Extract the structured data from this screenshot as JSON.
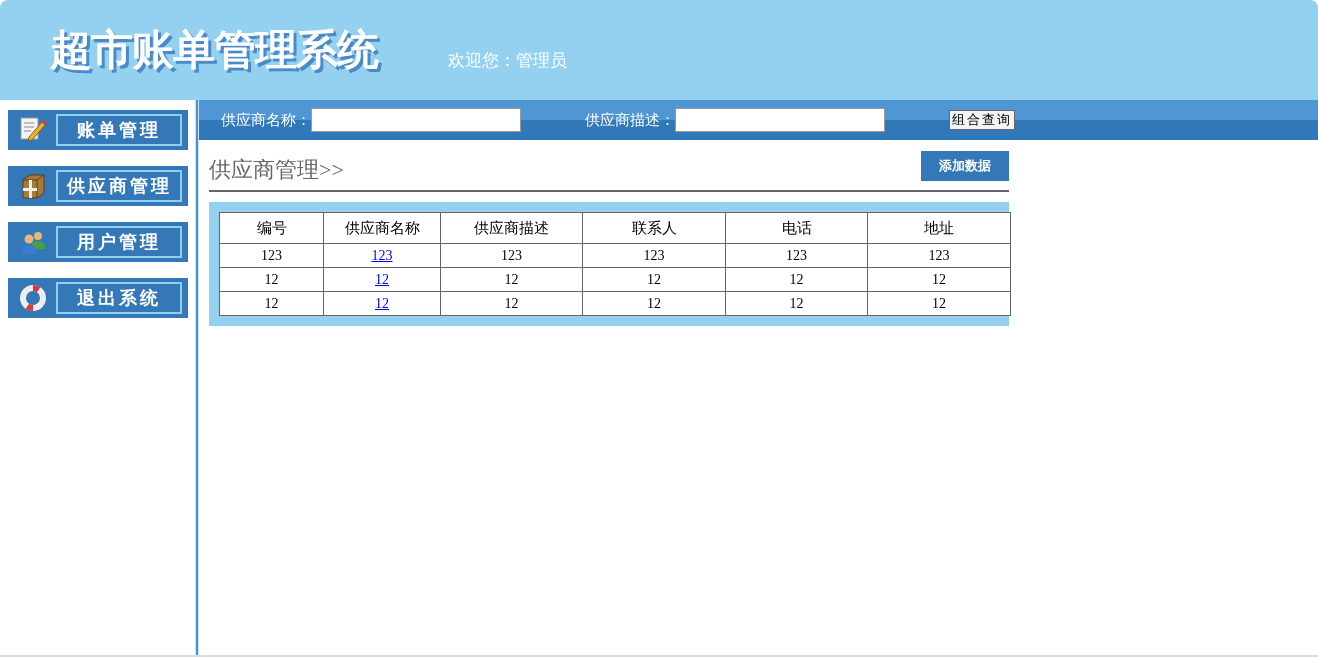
{
  "header": {
    "title": "超市账单管理系统",
    "welcome": "欢迎您：管理员"
  },
  "sidebar": {
    "items": [
      {
        "label": "账单管理"
      },
      {
        "label": "供应商管理"
      },
      {
        "label": "用户管理"
      },
      {
        "label": "退出系统"
      }
    ]
  },
  "search": {
    "fields": [
      {
        "label": "供应商名称："
      },
      {
        "label": "供应商描述："
      }
    ],
    "button": "组合查询"
  },
  "section": {
    "title": "供应商管理>>",
    "add_button": "添加数据"
  },
  "table": {
    "columns": [
      "编号",
      "供应商名称",
      "供应商描述",
      "联系人",
      "电话",
      "地址"
    ],
    "rows": [
      [
        "123",
        "123",
        "123",
        "123",
        "123",
        "123"
      ],
      [
        "12",
        "12",
        "12",
        "12",
        "12",
        "12"
      ],
      [
        "12",
        "12",
        "12",
        "12",
        "12",
        "12"
      ]
    ]
  }
}
